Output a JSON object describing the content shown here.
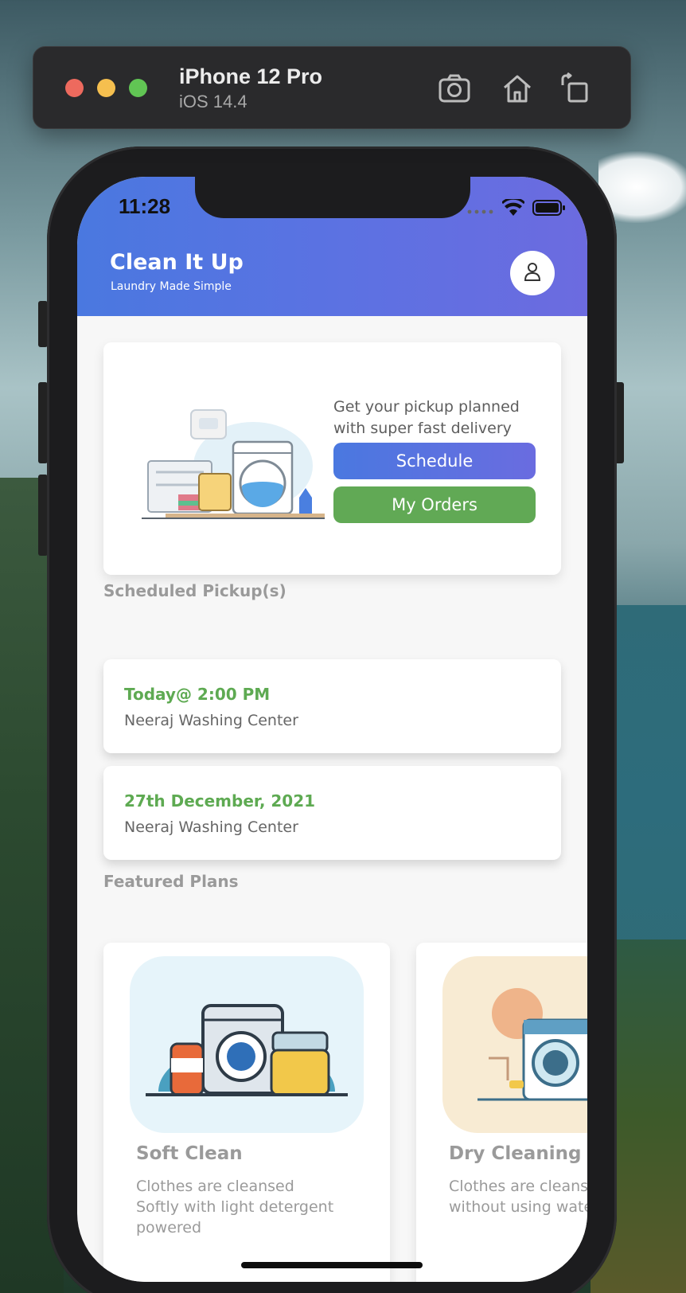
{
  "simulator": {
    "device_name": "iPhone 12 Pro",
    "os_version": "iOS 14.4",
    "icons": [
      "screenshot-icon",
      "home-icon",
      "rotate-icon"
    ]
  },
  "status_bar": {
    "time": "11:28",
    "icons": [
      "wifi-icon",
      "battery-icon"
    ]
  },
  "header": {
    "title": "Clean It Up",
    "subtitle": "Laundry Made Simple",
    "gradient": [
      "#4a78e0",
      "#6c6be0"
    ],
    "profile_icon": "user-icon"
  },
  "promo": {
    "text": "Get your pickup planned with super fast delivery",
    "schedule_label": "Schedule",
    "orders_label": "My Orders",
    "illustration": "laundry-illustration",
    "schedule_color": "#5b72e2",
    "orders_color": "#61a955"
  },
  "pickups": {
    "section_title": "Scheduled Pickup(s)",
    "items": [
      {
        "date": "Today@ 2:00 PM",
        "center": "Neeraj Washing Center"
      },
      {
        "date": "27th December, 2021",
        "center": "Neeraj Washing Center"
      }
    ],
    "date_color": "#5eaa52"
  },
  "plans": {
    "section_title": "Featured Plans",
    "items": [
      {
        "name": "Soft Clean",
        "description": "Clothes are cleansed Softly with light detergent powered",
        "image": "washing-machine-illustration",
        "bg": "#e6f4fa"
      },
      {
        "name": "Dry Cleaning",
        "description": "Clothes are cleansed without using water at all.",
        "image": "dry-cleaning-illustration",
        "bg": "#f8ebd3"
      }
    ]
  }
}
